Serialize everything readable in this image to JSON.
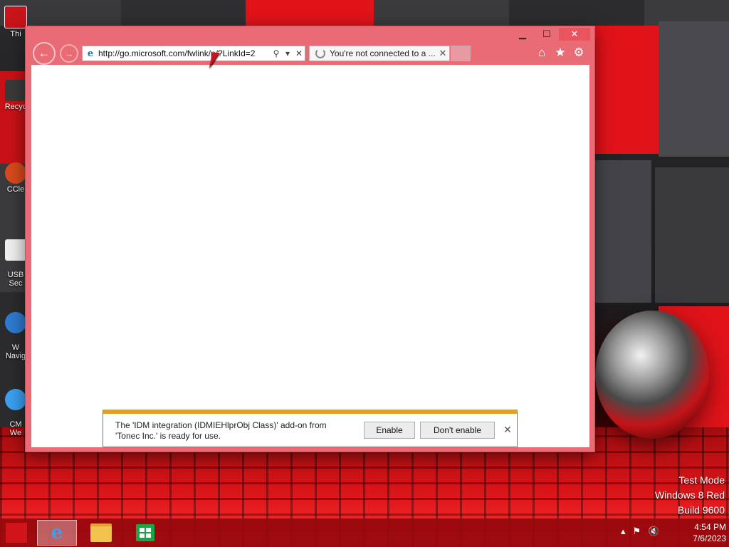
{
  "desktop": {
    "icons": [
      {
        "label": "Thi",
        "icon": "this-pc-icon"
      },
      {
        "label": "Recyc",
        "icon": "recycle-bin-icon"
      },
      {
        "label": "CCle",
        "icon": "ccleaner-icon"
      },
      {
        "label": "USB\nSec",
        "icon": "usb-security-icon"
      },
      {
        "label": "W\nNavig",
        "icon": "navigator-icon"
      },
      {
        "label": "CM\nWe",
        "icon": "ie-shortcut-icon"
      }
    ],
    "watermark": {
      "line1": "Test Mode",
      "line2": "Windows 8 Red",
      "line3": "Build 9600"
    }
  },
  "browser": {
    "window_controls": {
      "minimize": "▁",
      "maximize": "☐",
      "close": "✕"
    },
    "back_icon": "←",
    "forward_icon": "→",
    "address": {
      "url": "http://go.microsoft.com/fwlink/p/?LinkId=2",
      "search_glyph": "⚲",
      "dropdown_glyph": "▾",
      "stop_glyph": "✕"
    },
    "tab": {
      "title": "You're not connected to a ...",
      "close_glyph": "✕"
    },
    "toolbar": {
      "home": "⌂",
      "favorites": "★",
      "settings": "⚙"
    }
  },
  "notification": {
    "message": "The 'IDM integration (IDMIEHlprObj Class)' add-on from 'Tonec Inc.' is ready for use.",
    "enable_label": "Enable",
    "dont_enable_label": "Don't enable",
    "close_glyph": "✕",
    "accent_color": "#e3a21a"
  },
  "taskbar": {
    "pinned": [
      "internet-explorer",
      "file-explorer",
      "windows-store"
    ],
    "ie_glyph": "e",
    "tray": {
      "chevron": "▴",
      "network": "⚑",
      "volume": "🔇"
    },
    "clock": {
      "time": "4:54 PM",
      "date": "7/6/2023"
    }
  },
  "colors": {
    "window_frame": "#e86b76",
    "taskbar": "#96080c",
    "close_button": "#e9545f"
  }
}
